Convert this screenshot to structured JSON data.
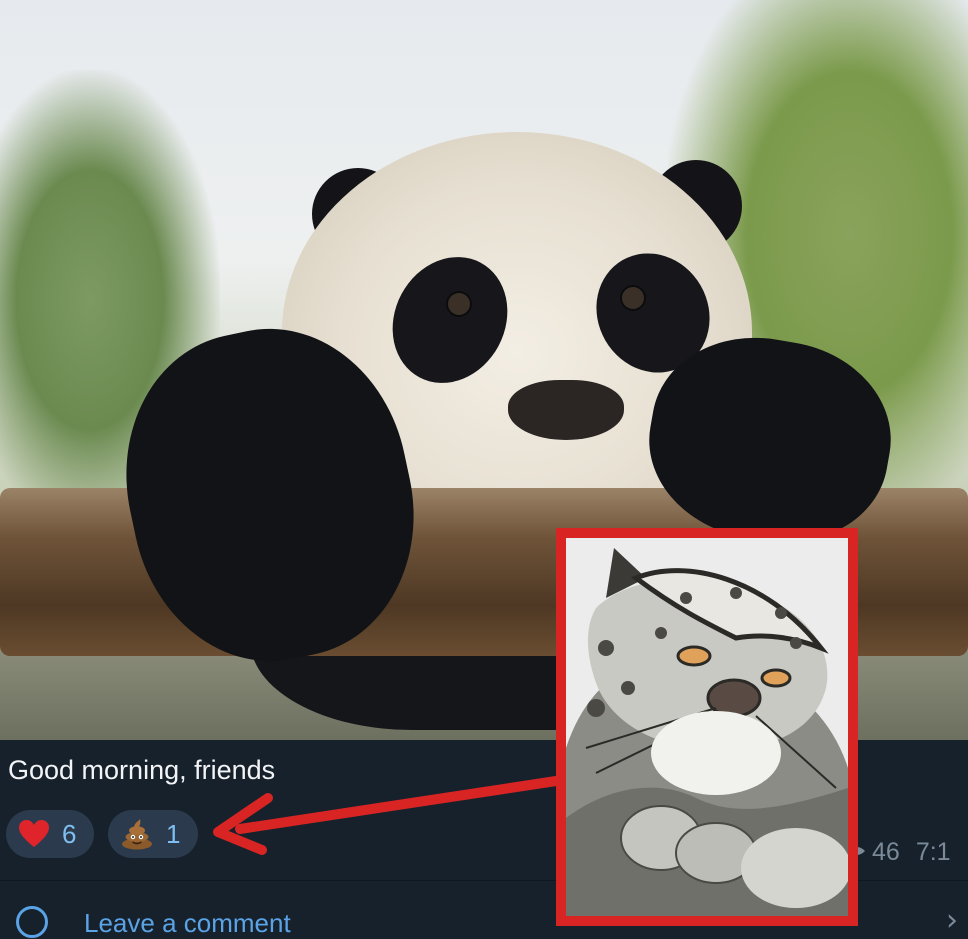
{
  "post": {
    "caption": "Good morning, friends"
  },
  "reactions": [
    {
      "emoji": "heart-icon",
      "count": "6"
    },
    {
      "emoji": "pile-of-poo-icon",
      "count": "1"
    }
  ],
  "meta": {
    "views": "46",
    "time": "7:1"
  },
  "comment": {
    "label": "Leave a comment"
  },
  "colors": {
    "panel_background": "#17212b",
    "reaction_pill": "#2b3b4d",
    "reaction_count": "#7fbef0",
    "link_blue": "#5aa3e6",
    "highlight_red": "#d92424"
  }
}
